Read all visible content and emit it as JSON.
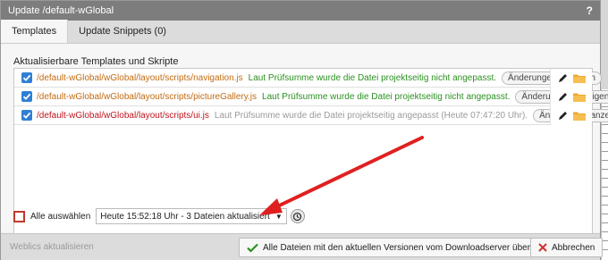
{
  "window": {
    "title": "Update /default-wGlobal",
    "help": "?"
  },
  "tabs": [
    {
      "label": "Templates",
      "active": true
    },
    {
      "label": "Update Snippets (0)",
      "active": false
    }
  ],
  "section_label": "Aktualisierbare Templates und Skripte",
  "files": [
    {
      "path": "/default-wGlobal/wGlobal/layout/scripts/navigation.js",
      "path_color": "orange",
      "status": "Laut Prüfsumme wurde die Datei projektseitig nicht angepasst.",
      "status_color": "green",
      "action": "Änderungen anzeigen",
      "checked": true
    },
    {
      "path": "/default-wGlobal/wGlobal/layout/scripts/pictureGallery.js",
      "path_color": "orange",
      "status": "Laut Prüfsumme wurde die Datei projektseitig nicht angepasst.",
      "status_color": "green",
      "action": "Änderungen anzeigen",
      "checked": true
    },
    {
      "path": "/default-wGlobal/wGlobal/layout/scripts/ui.js",
      "path_color": "red",
      "status": "Laut Prüfsumme wurde die Datei projektseitig angepasst (Heute 07:47:20 Uhr).",
      "status_color": "gray",
      "action": "Änderungen anzeigen",
      "checked": true
    }
  ],
  "select_all": {
    "label": "Alle auswählen",
    "checked": false
  },
  "version_select": {
    "value": "Heute 15:52:18 Uhr - 3 Dateien aktualisiert"
  },
  "footer": {
    "left_label": "Weblics aktualisieren",
    "confirm_label": "Alle Dateien mit den aktuellen Versionen vom Downloadserver überspielen",
    "cancel_label": "Abbrechen"
  },
  "colors": {
    "titlebar": "#7d7d7d",
    "checkbox": "#2f7fd5",
    "path_orange": "#c26b12",
    "path_red": "#c0141d",
    "status_green": "#2b9120",
    "annotation": "#e02020",
    "folder": "#f0a830"
  },
  "icons": [
    "help-icon",
    "checkmark-icon",
    "pencil-icon",
    "folder-icon",
    "history-icon",
    "confirm-check-icon",
    "cancel-x-icon"
  ]
}
